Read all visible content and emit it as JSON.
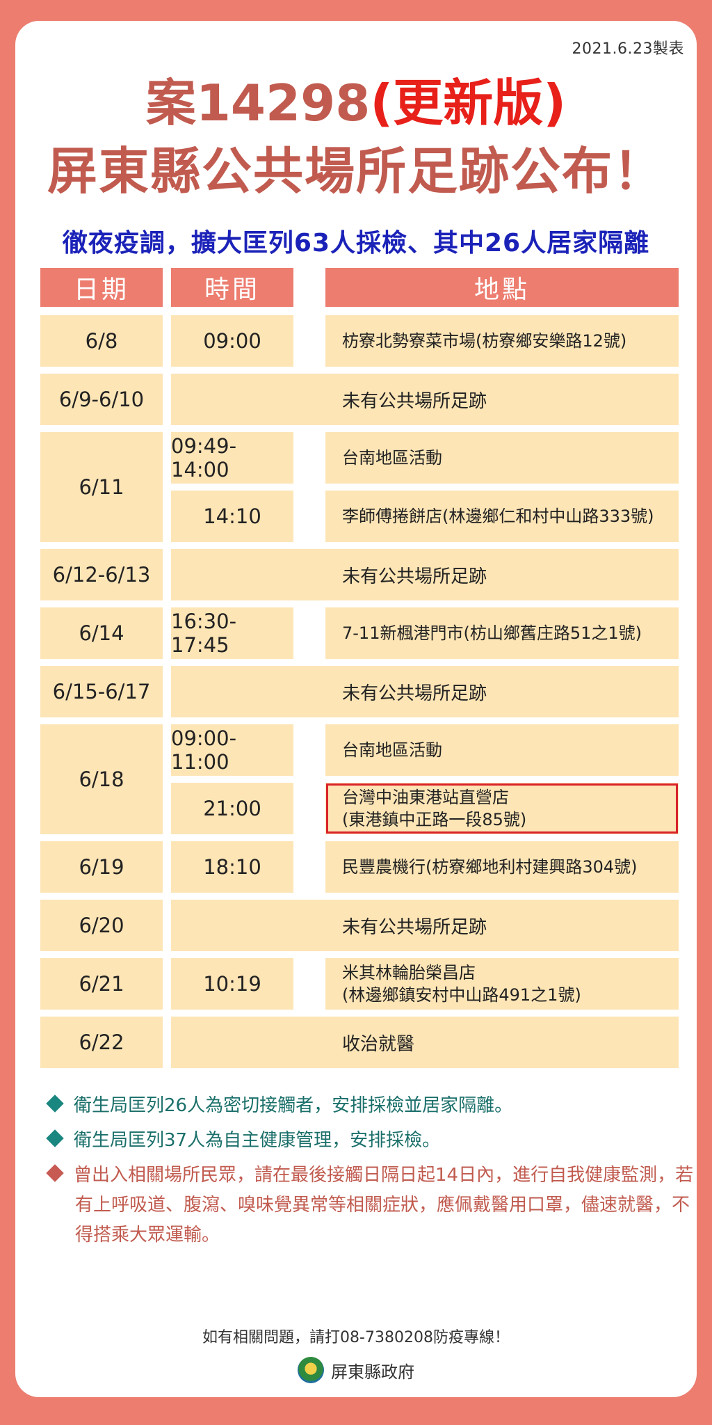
{
  "made_date": "2021.6.23製表",
  "title": {
    "prefix": "案14298",
    "highlight": "(更新版)",
    "line2": "屏東縣公共場所足跡公布！"
  },
  "subtitle": "徹夜疫調，擴大匡列63人採檢、其中26人居家隔離",
  "table": {
    "headers": {
      "date": "日期",
      "time": "時間",
      "location": "地點"
    },
    "rows": [
      {
        "date": "6/8",
        "time": "09:00",
        "location": "枋寮北勢寮菜市場(枋寮鄉安樂路12號)"
      },
      {
        "date": "6/9-6/10",
        "note": "未有公共場所足跡"
      },
      {
        "date": "6/11",
        "time_a": "09:49-14:00",
        "location_a": "台南地區活動",
        "time_b": "14:10",
        "location_b": "李師傅捲餅店(林邊鄉仁和村中山路333號)"
      },
      {
        "date": "6/12-6/13",
        "note": "未有公共場所足跡"
      },
      {
        "date": "6/14",
        "time": "16:30-17:45",
        "location": "7-11新楓港門市(枋山鄉舊庄路51之1號)"
      },
      {
        "date": "6/15-6/17",
        "note": "未有公共場所足跡"
      },
      {
        "date": "6/18",
        "time_a": "09:00-11:00",
        "location_a": "台南地區活動",
        "time_b": "21:00",
        "location_b_1": "台灣中油東港站直營店",
        "location_b_2": "(東港鎮中正路一段85號)"
      },
      {
        "date": "6/19",
        "time": "18:10",
        "location": "民豐農機行(枋寮鄉地利村建興路304號)"
      },
      {
        "date": "6/20",
        "note": "未有公共場所足跡"
      },
      {
        "date": "6/21",
        "time": "10:19",
        "location_1": "米其林輪胎榮昌店",
        "location_2": "(林邊鄉鎮安村中山路491之1號)"
      },
      {
        "date": "6/22",
        "note": "收治就醫"
      }
    ]
  },
  "bullets": [
    "衛生局匡列26人為密切接觸者，安排採檢並居家隔離。",
    "衛生局匡列37人為自主健康管理，安排採檢。",
    "曾出入相關場所民眾，請在最後接觸日隔日起14日內，進行自我健康監測，若有上呼吸道、腹瀉、嗅味覺異常等相關症狀，應佩戴醫用口罩，儘速就醫，不得搭乘大眾運輸。"
  ],
  "hotline": "如有相關問題，請打08-7380208防疫專線！",
  "org": "屏東縣政府",
  "colors": {
    "background": "#ec7d6f",
    "cell": "#fde5b6",
    "title": "#c15b4f",
    "title_red": "#e8201a",
    "subtitle": "#1b22b8",
    "teal": "#1a6f6a",
    "highlight_border": "#d8232a"
  }
}
